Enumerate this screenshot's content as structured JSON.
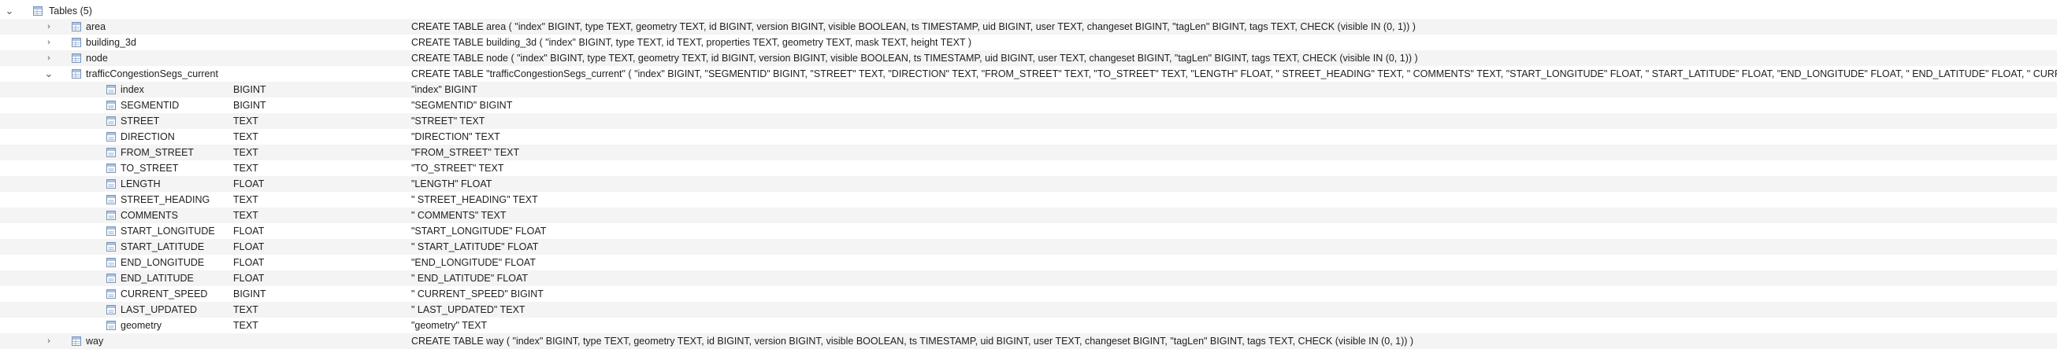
{
  "tree": {
    "root": {
      "label": "Tables (5)",
      "expanded": true,
      "icon": "table-group-icon"
    },
    "tables": [
      {
        "name": "area",
        "expanded": false,
        "schema": "CREATE TABLE area ( \"index\" BIGINT, type TEXT, geometry TEXT, id BIGINT, version BIGINT, visible BOOLEAN, ts TIMESTAMP, uid BIGINT, user TEXT, changeset BIGINT, \"tagLen\" BIGINT, tags TEXT, CHECK (visible IN (0, 1)) )",
        "columns": []
      },
      {
        "name": "building_3d",
        "expanded": false,
        "schema": "CREATE TABLE building_3d ( \"index\" BIGINT, type TEXT, id TEXT, properties TEXT, geometry TEXT, mask TEXT, height TEXT )",
        "columns": []
      },
      {
        "name": "node",
        "expanded": false,
        "schema": "CREATE TABLE node ( \"index\" BIGINT, type TEXT, geometry TEXT, id BIGINT, version BIGINT, visible BOOLEAN, ts TIMESTAMP, uid BIGINT, user TEXT, changeset BIGINT, \"tagLen\" BIGINT, tags TEXT, CHECK (visible IN (0, 1)) )",
        "columns": []
      },
      {
        "name": "trafficCongestionSegs_current",
        "expanded": true,
        "schema": "CREATE TABLE \"trafficCongestionSegs_current\" ( \"index\" BIGINT, \"SEGMENTID\" BIGINT, \"STREET\" TEXT, \"DIRECTION\" TEXT, \"FROM_STREET\" TEXT, \"TO_STREET\" TEXT, \"LENGTH\" FLOAT, \" STREET_HEADING\" TEXT, \" COMMENTS\" TEXT, \"START_LONGITUDE\" FLOAT, \" START_LATITUDE\" FLOAT, \"END_LONGITUDE\" FLOAT, \" END_LATITUDE\" FLOAT, \" CURRENT_SPEED\" BIGINT, \" LAST_UPDATED\" TEXT, \"geometry\" TEXT )",
        "columns": [
          {
            "name": "index",
            "type": "BIGINT",
            "schema": "\"index\" BIGINT"
          },
          {
            "name": "SEGMENTID",
            "type": "BIGINT",
            "schema": "\"SEGMENTID\" BIGINT"
          },
          {
            "name": "STREET",
            "type": "TEXT",
            "schema": "\"STREET\" TEXT"
          },
          {
            "name": "DIRECTION",
            "type": "TEXT",
            "schema": "\"DIRECTION\" TEXT"
          },
          {
            "name": "FROM_STREET",
            "type": "TEXT",
            "schema": "\"FROM_STREET\" TEXT"
          },
          {
            "name": "TO_STREET",
            "type": "TEXT",
            "schema": "\"TO_STREET\" TEXT"
          },
          {
            "name": "LENGTH",
            "type": "FLOAT",
            "schema": "\"LENGTH\" FLOAT"
          },
          {
            "name": "STREET_HEADING",
            "type": "TEXT",
            "schema": "\" STREET_HEADING\" TEXT"
          },
          {
            "name": "COMMENTS",
            "type": "TEXT",
            "schema": "\" COMMENTS\" TEXT"
          },
          {
            "name": "START_LONGITUDE",
            "type": "FLOAT",
            "schema": "\"START_LONGITUDE\" FLOAT"
          },
          {
            "name": "START_LATITUDE",
            "type": "FLOAT",
            "schema": "\" START_LATITUDE\" FLOAT"
          },
          {
            "name": "END_LONGITUDE",
            "type": "FLOAT",
            "schema": "\"END_LONGITUDE\" FLOAT"
          },
          {
            "name": "END_LATITUDE",
            "type": "FLOAT",
            "schema": "\" END_LATITUDE\" FLOAT"
          },
          {
            "name": "CURRENT_SPEED",
            "type": "BIGINT",
            "schema": "\" CURRENT_SPEED\" BIGINT"
          },
          {
            "name": "LAST_UPDATED",
            "type": "TEXT",
            "schema": "\" LAST_UPDATED\" TEXT"
          },
          {
            "name": "geometry",
            "type": "TEXT",
            "schema": "\"geometry\" TEXT"
          }
        ]
      },
      {
        "name": "way",
        "expanded": false,
        "schema": "CREATE TABLE way ( \"index\" BIGINT, type TEXT, geometry TEXT, id BIGINT, version BIGINT, visible BOOLEAN, ts TIMESTAMP, uid BIGINT, user TEXT, changeset BIGINT, \"tagLen\" BIGINT, tags TEXT, CHECK (visible IN (0, 1)) )",
        "columns": []
      }
    ]
  },
  "icons": {
    "table": "table-icon",
    "field": "field-icon",
    "collapsed_arrow": "chevron-right-icon",
    "expanded_arrow": "chevron-down-icon"
  },
  "colors": {
    "row_alt": "#f4f4f4",
    "selected_row": "#eef3fb",
    "icon_border": "#7a94b8",
    "icon_header": "#a9c3e6",
    "icon_fill": "#ffffff"
  }
}
